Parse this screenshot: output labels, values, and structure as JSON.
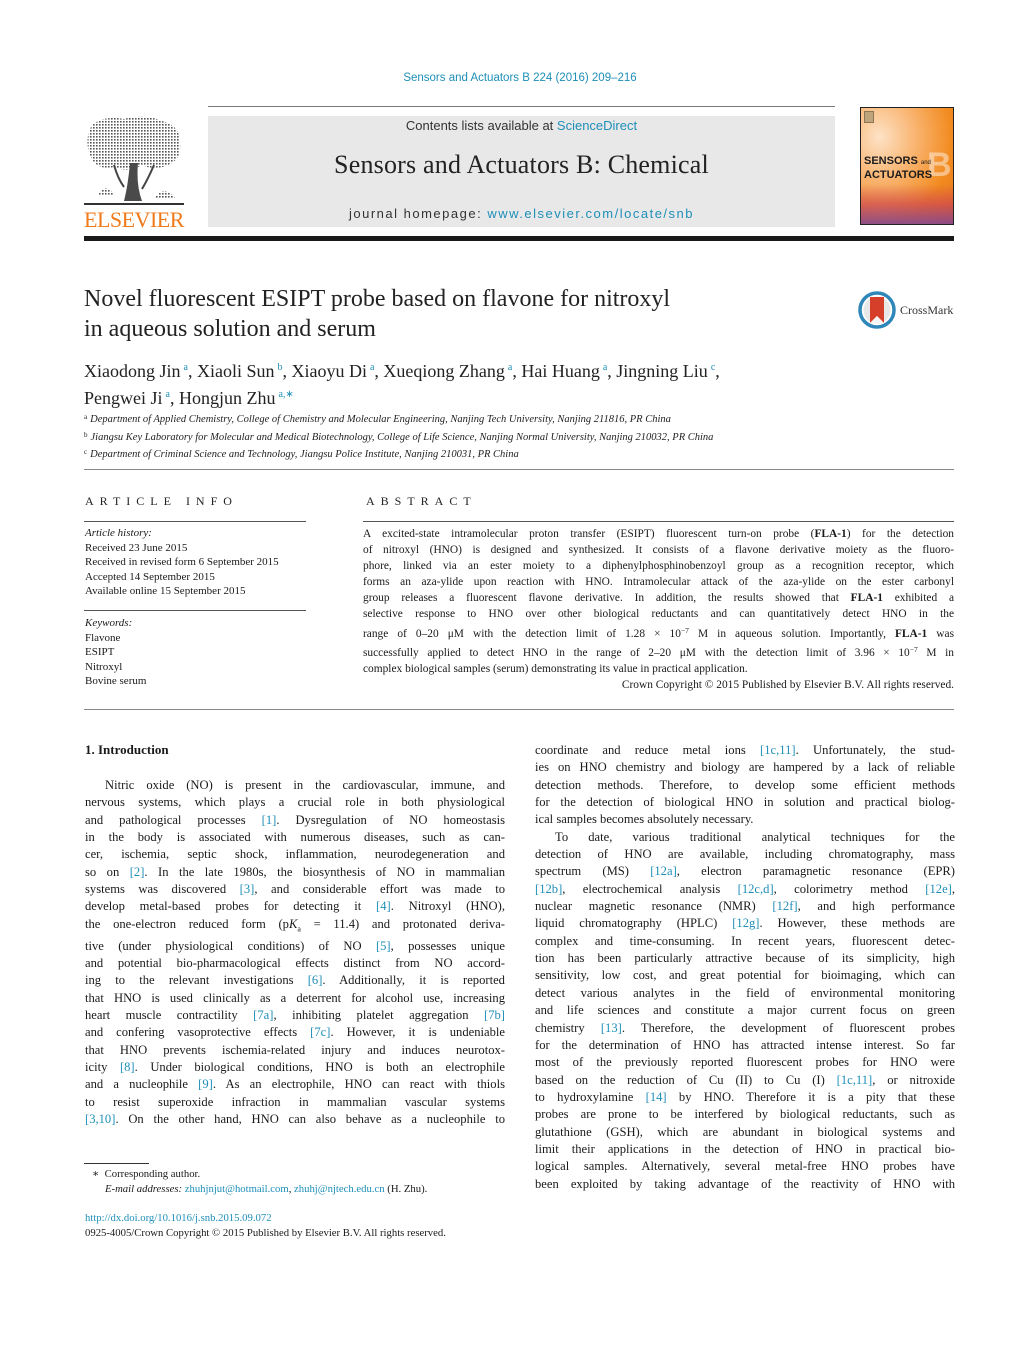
{
  "citation": "Sensors and Actuators B 224 (2016) 209–216",
  "header": {
    "publisher_logo_text": "ELSEVIER",
    "contents_prefix": "Contents lists available at ",
    "contents_link": "ScienceDirect",
    "journal_title": "Sensors and Actuators B: Chemical",
    "homepage_prefix": "journal homepage: ",
    "homepage_link": "www.elsevier.com/locate/snb",
    "cover": {
      "line1": "SENSORS",
      "and": "and",
      "line2": "ACTUATORS",
      "letter": "B"
    },
    "colors": {
      "link": "#1f8fb8",
      "elsevier_orange": "#f07a1a",
      "banner_bg": "#e8e8e8"
    }
  },
  "article": {
    "title_lines": [
      "Novel fluorescent ESIPT probe based on flavone for nitroxyl",
      "in aqueous solution and serum"
    ],
    "crossmark_label": "CrossMark",
    "authors": [
      {
        "name": "Xiaodong Jin",
        "sup": "a",
        "sep": ", "
      },
      {
        "name": "Xiaoli Sun",
        "sup": "b",
        "sep": ", "
      },
      {
        "name": "Xiaoyu Di",
        "sup": "a",
        "sep": ", "
      },
      {
        "name": "Xueqiong Zhang",
        "sup": "a",
        "sep": ", "
      },
      {
        "name": "Hai Huang",
        "sup": "a",
        "sep": ", "
      },
      {
        "name": "Jingning Liu",
        "sup": "c",
        "sep": ","
      },
      {
        "name": "Pengwei Ji",
        "sup": "a",
        "sep": ", "
      },
      {
        "name": "Hongjun Zhu",
        "sup": "a,∗",
        "sep": ""
      }
    ],
    "affiliations": [
      {
        "key": "a",
        "text": "Department of Applied Chemistry, College of Chemistry and Molecular Engineering, Nanjing Tech University, Nanjing 211816, PR China"
      },
      {
        "key": "b",
        "text": "Jiangsu Key Laboratory for Molecular and Medical Biotechnology, College of Life Science, Nanjing Normal University, Nanjing 210032, PR China"
      },
      {
        "key": "c",
        "text": "Department of Criminal Science and Technology, Jiangsu Police Institute, Nanjing 210031, PR China"
      }
    ]
  },
  "article_info": {
    "heading": "ARTICLE INFO",
    "history_label": "Article history:",
    "history": [
      "Received 23 June 2015",
      "Received in revised form 6 September 2015",
      "Accepted 14 September 2015",
      "Available online 15 September 2015"
    ],
    "keywords_label": "Keywords:",
    "keywords": [
      "Flavone",
      "ESIPT",
      "Nitroxyl",
      "Bovine serum"
    ]
  },
  "abstract": {
    "heading": "ABSTRACT",
    "lines": [
      "A excited-state intramolecular proton transfer (ESIPT) fluorescent turn-on probe (<b>FLA-1</b>) for the detection",
      "of nitroxyl (HNO) is designed and synthesized. It consists of a flavone derivative moiety as the fluoro-",
      "phore, linked via an ester moiety to a diphenylphosphinobenzoyl group as a recognition receptor, which",
      "forms an aza-ylide upon reaction with HNO. Intramolecular attack of the aza-ylide on the ester carbonyl",
      "group releases a fluorescent flavone derivative. In addition, the results showed that <b>FLA-1</b> exhibited a",
      "selective response to HNO over other biological reductants and can quantitatively detect HNO in the",
      "range of 0–20 μM with the detection limit of 1.28 × 10<sup>−7</sup> M in aqueous solution. Importantly, <b>FLA-1</b> was",
      "successfully applied to detect HNO in the range of 2–20 μM with the detection limit of 3.96 × 10<sup>−7</sup> M in",
      "complex biological samples (serum) demonstrating its value in practical application."
    ],
    "copyright": "Crown Copyright © 2015 Published by Elsevier B.V. All rights reserved."
  },
  "introduction": {
    "heading": "1.  Introduction",
    "left_lines": [
      "Nitric oxide (NO) is present in the cardiovascular, immune, and",
      "nervous systems, which plays a crucial role in both physiological",
      "and pathological processes <a>[1]</a>. Dysregulation of NO homeostasis",
      "in the body is associated with numerous diseases, such as can-",
      "cer, ischemia, septic shock, inflammation, neurodegeneration and",
      "so on <a>[2]</a>. In the late 1980s, the biosynthesis of NO in mammalian",
      "systems was discovered <a>[3]</a>, and considerable effort was made to",
      "develop metal-based probes for detecting it <a>[4]</a>. Nitroxyl (HNO),",
      "the one-electron reduced form (p<i>K</i><sub>a</sub> = 11.4) and protonated deriva-",
      "tive (under physiological conditions) of NO <a>[5]</a>, possesses unique",
      "and potential bio-pharmacological effects distinct from NO accord-",
      "ing to the relevant investigations <a>[6]</a>. Additionally, it is reported",
      "that HNO is used clinically as a deterrent for alcohol use, increasing",
      "heart muscle contractility <a>[7a]</a>, inhibiting platelet aggregation <a>[7b]</a>",
      "and confering vasoprotective effects <a>[7c]</a>. However, it is undeniable",
      "that HNO prevents ischemia-related injury and induces neurotox-",
      "icity <a>[8]</a>. Under biological conditions, HNO is both an electrophile",
      "and a nucleophile <a>[9]</a>. As an electrophile, HNO can react with thiols",
      "to resist superoxide infraction in mammalian vascular systems",
      "<a>[3,10]</a>. On the other hand, HNO can also behave as a nucleophile to"
    ],
    "right_lines": [
      "coordinate and reduce metal ions <a>[1c,11]</a>. Unfortunately, the stud-",
      "ies on HNO chemistry and biology are hampered by a lack of reliable",
      "detection methods. Therefore, to develop some efficient methods",
      "for the detection of biological HNO in solution and practical biolog-",
      "ical samples becomes absolutely necessary.",
      "To date, various traditional analytical techniques for the",
      "detection of HNO are available, including chromatography, mass",
      "spectrum (MS) <a>[12a]</a>, electron paramagnetic resonance (EPR)",
      "<a>[12b]</a>, electrochemical analysis <a>[12c,d]</a>, colorimetry method <a>[12e]</a>,",
      "nuclear magnetic resonance (NMR) <a>[12f]</a>, and high performance",
      "liquid chromatography (HPLC) <a>[12g]</a>. However, these methods are",
      "complex and time-consuming. In recent years, fluorescent detec-",
      "tion has been particularly attractive because of its simplicity, high",
      "sensitivity, low cost, and great potential for bioimaging, which can",
      "detect various analytes in the field of environmental monitoring",
      "and life sciences and constitute a major current focus on green",
      "chemistry <a>[13]</a>. Therefore, the development of fluorescent probes",
      "for the determination of HNO has attracted intense interest. So far",
      "most of the previously reported fluorescent probes for HNO were",
      "based on the reduction of Cu (II) to Cu (I) <a>[1c,11]</a>, or nitroxide",
      "to hydroxylamine <a>[14]</a> by HNO. Therefore it is a pity that these",
      "probes are prone to be interfered by biological reductants, such as",
      "glutathione (GSH), which are abundant in biological systems and",
      "limit their applications in the detection of HNO in practical bio-",
      "logical samples. Alternatively, several metal-free HNO probes have",
      "been exploited by taking advantage of the reactivity of HNO with"
    ],
    "left_indent_lines": [
      0
    ],
    "left_last_lines": [],
    "right_indent_lines": [
      5
    ],
    "right_last_lines": [
      4
    ]
  },
  "footnotes": {
    "corresponding_mark": "∗",
    "corresponding_text": "Corresponding author.",
    "email_label": "E-mail addresses:",
    "email1": "zhuhjnjut@hotmail.com",
    "email2": "zhuhj@njtech.edu.cn",
    "email_owner": " (H. Zhu).",
    "doi": "http://dx.doi.org/10.1016/j.snb.2015.09.072",
    "issn_copyright": "0925-4005/Crown Copyright © 2015 Published by Elsevier B.V. All rights reserved."
  }
}
